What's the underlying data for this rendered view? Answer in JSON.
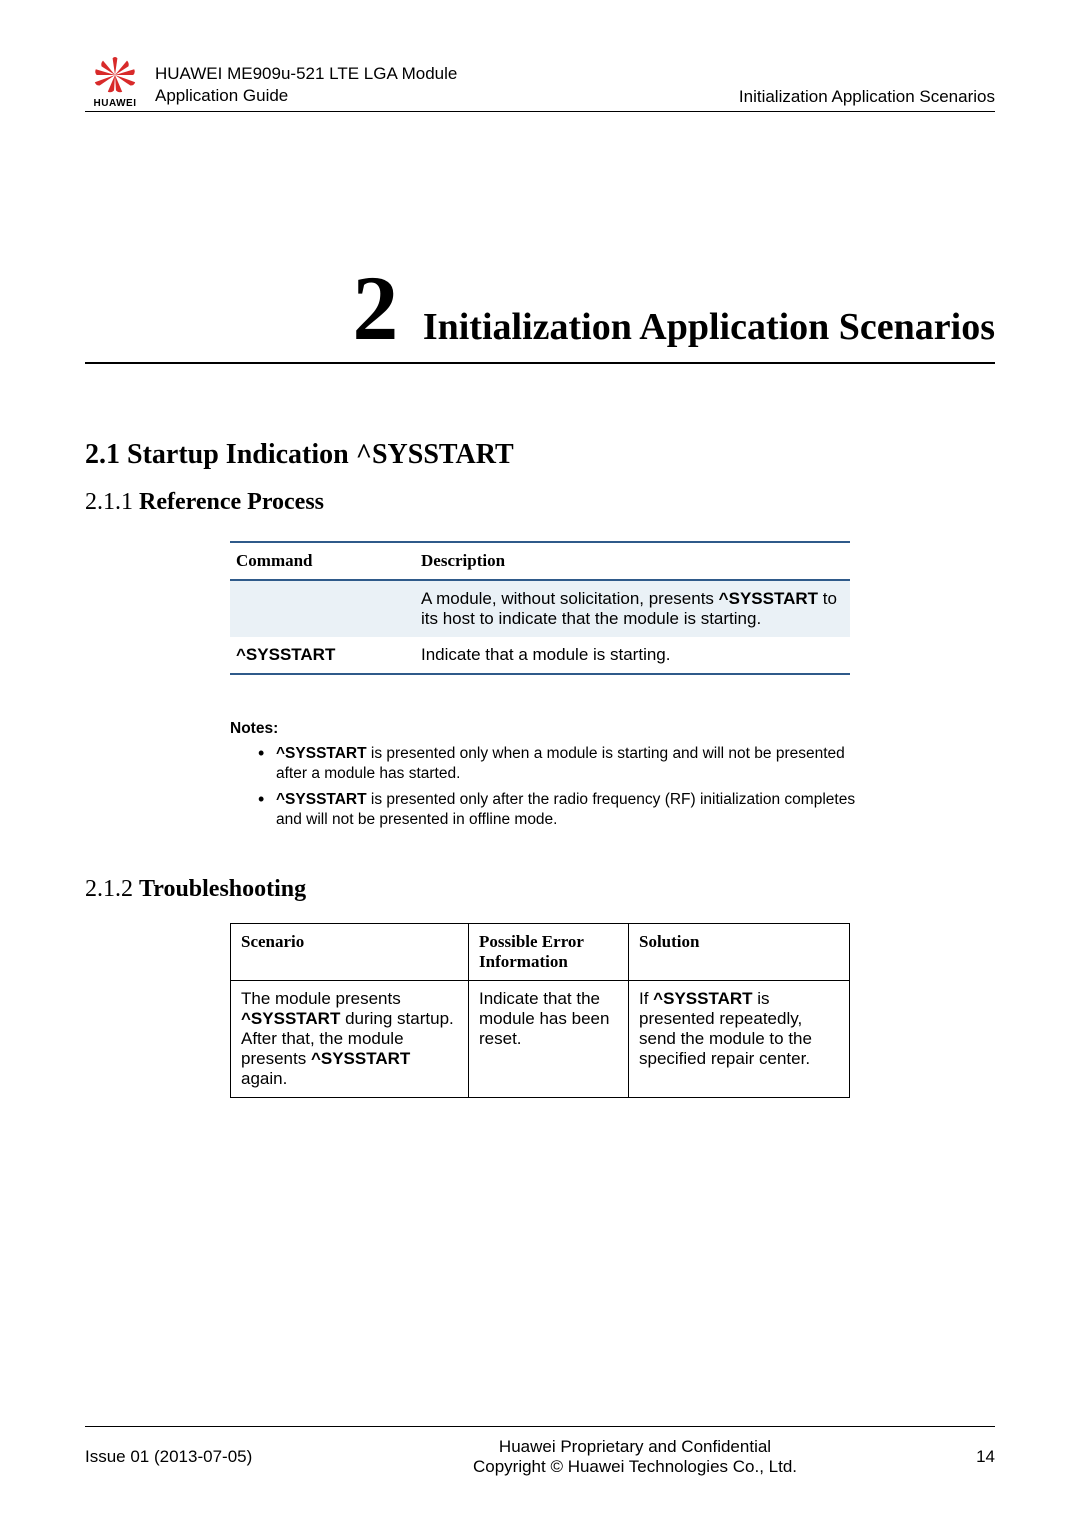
{
  "header": {
    "logo_text": "HUAWEI",
    "doc_title_line1": "HUAWEI ME909u-521 LTE LGA Module",
    "doc_title_line2": "Application Guide",
    "right_text": "Initialization Application Scenarios"
  },
  "chapter": {
    "number": "2",
    "title": "Initialization Application Scenarios"
  },
  "section_2_1": {
    "heading": "2.1 Startup Indication ^SYSSTART"
  },
  "section_2_1_1": {
    "num": "2.1.1 ",
    "title": "Reference Process",
    "table": {
      "headers": {
        "cmd": "Command",
        "desc": "Description"
      },
      "row1": {
        "cmd": "",
        "desc_pre": "A module, without solicitation, presents ",
        "desc_bold": "^SYSSTART",
        "desc_post": " to its host to indicate that the module is starting."
      },
      "row2": {
        "cmd": "^SYSSTART",
        "desc": "Indicate that a module is starting."
      }
    },
    "notes_label": "Notes:",
    "notes": {
      "n1_bold": "^SYSSTART",
      "n1_rest": " is presented only when a module is starting and will not be presented after a module has started.",
      "n2_bold": "^SYSSTART",
      "n2_rest": " is presented only after the radio frequency (RF) initialization completes and will not be presented in offline mode."
    }
  },
  "section_2_1_2": {
    "num": "2.1.2 ",
    "title": "Troubleshooting",
    "table": {
      "headers": {
        "scenario": "Scenario",
        "error": "Possible Error Information",
        "solution": "Solution"
      },
      "row1": {
        "scenario_pre": "The module presents ",
        "scenario_b1": "^SYSSTART",
        "scenario_mid": " during startup. After that, the module presents ",
        "scenario_b2": "^SYSSTART",
        "scenario_post": " again.",
        "error": "Indicate that the module has been reset.",
        "solution_pre": "If ",
        "solution_bold": "^SYSSTART",
        "solution_post": " is presented repeatedly, send the module to the specified repair center."
      }
    }
  },
  "footer": {
    "left": "Issue 01 (2013-07-05)",
    "center_line1": "Huawei Proprietary and Confidential",
    "center_line2": "Copyright © Huawei Technologies Co., Ltd.",
    "page": "14"
  }
}
